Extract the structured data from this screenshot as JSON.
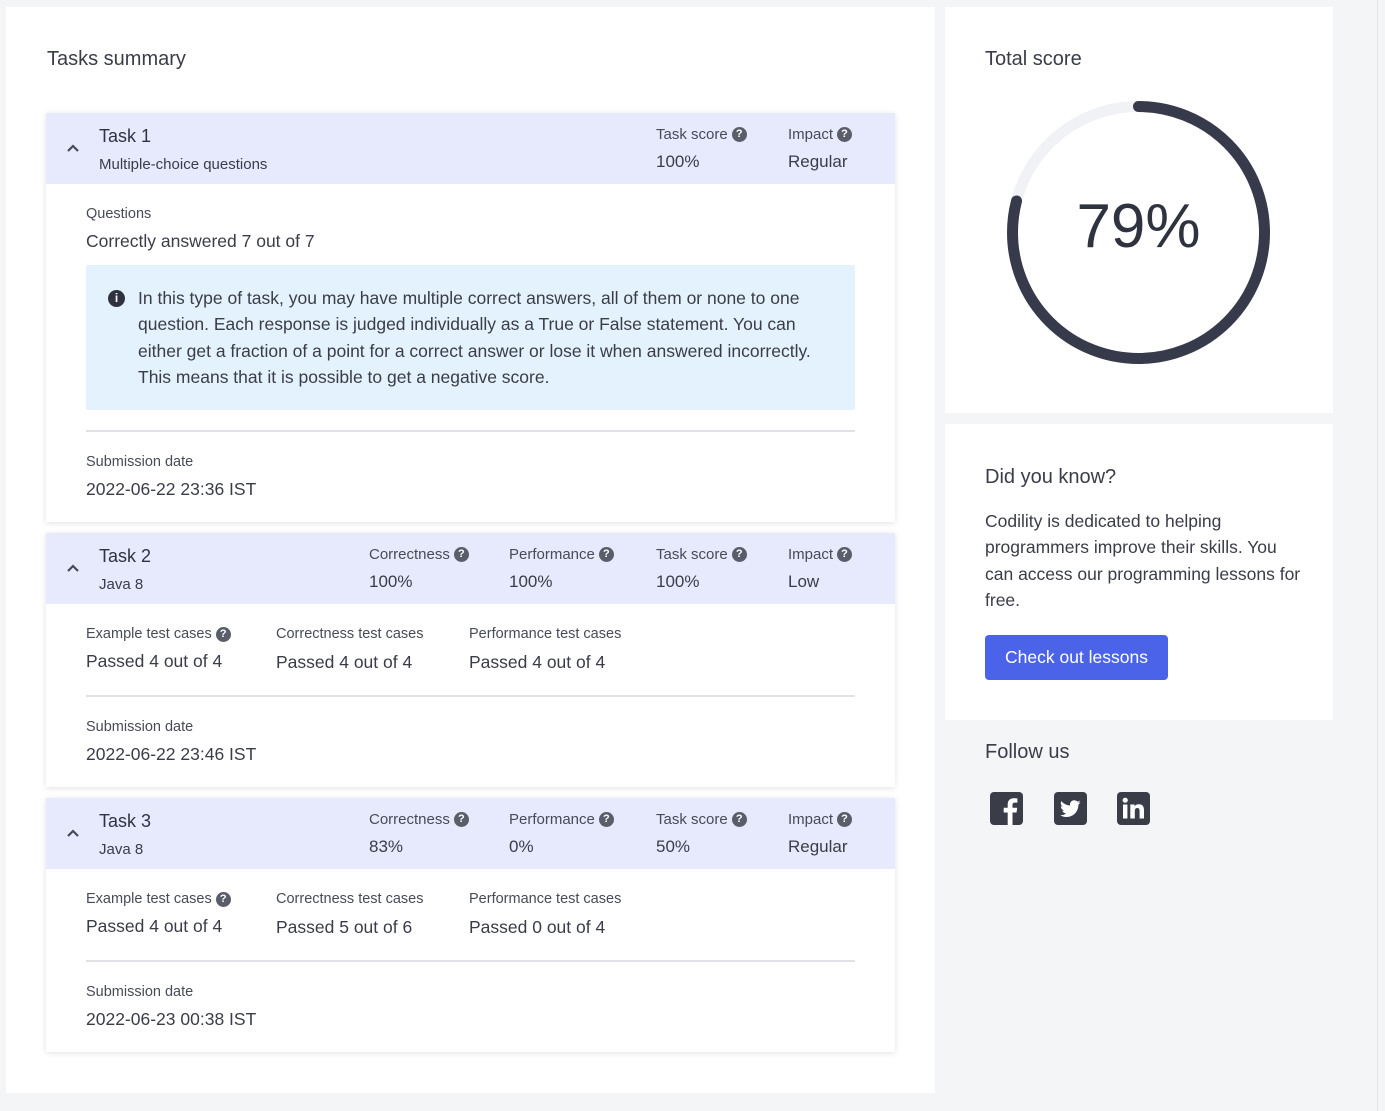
{
  "summary": {
    "title": "Tasks summary",
    "tasks": [
      {
        "name": "Task 1",
        "subtitle": "Multiple-choice questions",
        "metrics": [
          {
            "label": "Task score",
            "value": "100%"
          },
          {
            "label": "Impact",
            "value": "Regular"
          }
        ],
        "questions_label": "Questions",
        "questions_value": "Correctly answered 7 out of 7",
        "info": "In this type of task, you may have multiple correct answers, all of them or none to one question. Each response is judged individually as a True or False statement. You can either get a fraction of a point for a correct answer or lose it when answered incorrectly. This means that it is possible to get a negative score.",
        "submission_label": "Submission date",
        "submission_value": "2022-06-22 23:36 IST"
      },
      {
        "name": "Task 2",
        "subtitle": "Java 8",
        "metrics": [
          {
            "label": "Correctness",
            "value": "100%"
          },
          {
            "label": "Performance",
            "value": "100%"
          },
          {
            "label": "Task score",
            "value": "100%"
          },
          {
            "label": "Impact",
            "value": "Low"
          }
        ],
        "cases": [
          {
            "label": "Example test cases",
            "value": "Passed 4 out of 4"
          },
          {
            "label": "Correctness test cases",
            "value": "Passed 4 out of 4"
          },
          {
            "label": "Performance test cases",
            "value": "Passed 4 out of 4"
          }
        ],
        "submission_label": "Submission date",
        "submission_value": "2022-06-22 23:46 IST"
      },
      {
        "name": "Task 3",
        "subtitle": "Java 8",
        "metrics": [
          {
            "label": "Correctness",
            "value": "83%"
          },
          {
            "label": "Performance",
            "value": "0%"
          },
          {
            "label": "Task score",
            "value": "50%"
          },
          {
            "label": "Impact",
            "value": "Regular"
          }
        ],
        "cases": [
          {
            "label": "Example test cases",
            "value": "Passed 4 out of 4"
          },
          {
            "label": "Correctness test cases",
            "value": "Passed 5 out of 6"
          },
          {
            "label": "Performance test cases",
            "value": "Passed 0 out of 4"
          }
        ],
        "submission_label": "Submission date",
        "submission_value": "2022-06-23 00:38 IST"
      }
    ]
  },
  "total_score": {
    "title": "Total score",
    "value_text": "79%",
    "fraction": 0.79,
    "ring_color": "#363a4a",
    "track_color": "#f1f2f5"
  },
  "did_you_know": {
    "title": "Did you know?",
    "text": "Codility is dedicated to helping programmers improve their skills. You can access our programming lessons for free.",
    "button_label": "Check out lessons",
    "button_color": "#4a63e8"
  },
  "follow": {
    "title": "Follow us",
    "icons": [
      "facebook-icon",
      "twitter-icon",
      "linkedin-icon"
    ]
  },
  "help_glyph": "?",
  "info_glyph": "i"
}
